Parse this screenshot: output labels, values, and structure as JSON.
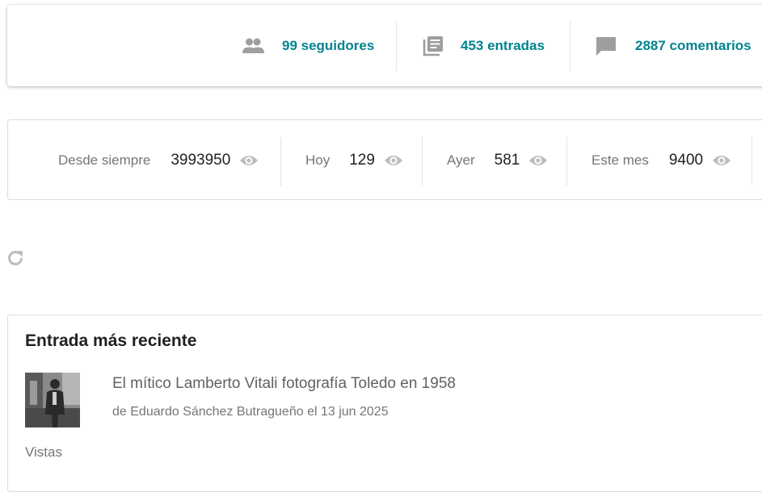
{
  "stats": {
    "followers": "99 seguidores",
    "posts": "453 entradas",
    "comments": "2887 comentarios",
    "accent": "#00838f"
  },
  "views": [
    {
      "label": "Desde siempre",
      "value": "3993950",
      "icon": "eye-icon"
    },
    {
      "label": "Hoy",
      "value": "129",
      "icon": "eye-icon"
    },
    {
      "label": "Ayer",
      "value": "581",
      "icon": "eye-icon"
    },
    {
      "label": "Este mes",
      "value": "9400",
      "icon": "eye-icon"
    }
  ],
  "recent": {
    "heading": "Entrada más reciente",
    "post_title": "El mítico Lamberto Vitali fotografía Toledo en 1958",
    "post_meta": "de Eduardo Sánchez Butragueño el 13 jun 2025",
    "views_label": "Vistas"
  },
  "icons": {
    "followers": "people-icon",
    "posts": "library-books-icon",
    "comments": "comment-icon",
    "refresh": "refresh-icon"
  }
}
